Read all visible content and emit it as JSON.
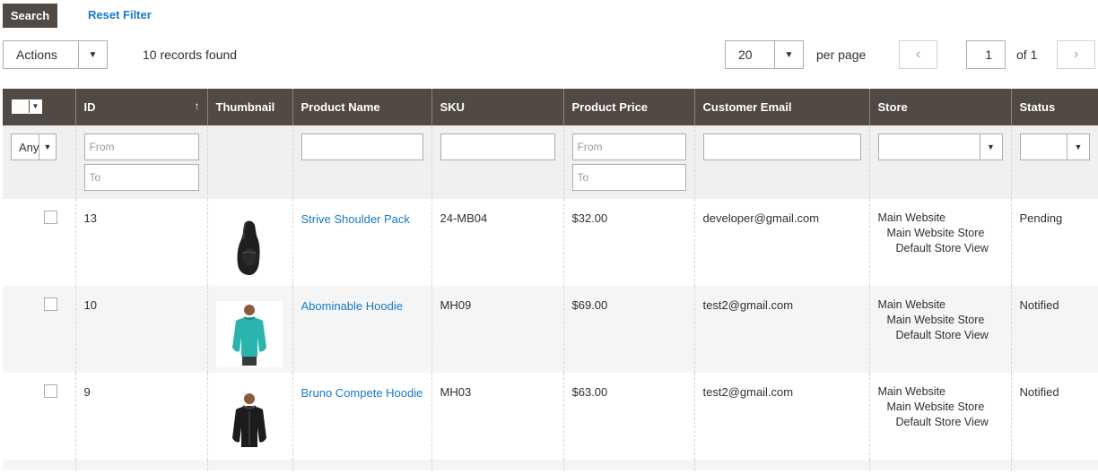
{
  "top": {
    "search_label": "Search",
    "reset_filter_label": "Reset Filter"
  },
  "toolbar": {
    "actions_label": "Actions",
    "records_found": "10 records found",
    "per_page_value": "20",
    "per_page_label": "per page",
    "page_current": "1",
    "page_total": "of 1",
    "prev_icon": "chevron-left-icon",
    "next_icon": "chevron-right-icon"
  },
  "grid": {
    "columns": [
      "ID",
      "Thumbnail",
      "Product Name",
      "SKU",
      "Product Price",
      "Customer Email",
      "Store",
      "Status"
    ],
    "sort_indicator": "↑",
    "filters": {
      "mass_any": "Any",
      "id_from_placeholder": "From",
      "id_to_placeholder": "To",
      "price_from_placeholder": "From",
      "price_to_placeholder": "To"
    },
    "rows": [
      {
        "id": "13",
        "thumbnail": "backpack-thumbnail",
        "product_name": "Strive Shoulder Pack",
        "sku": "24-MB04",
        "price": "$32.00",
        "email": "developer@gmail.com",
        "store": [
          "Main Website",
          "Main Website Store",
          "Default Store View"
        ],
        "status": "Pending"
      },
      {
        "id": "10",
        "thumbnail": "teal-hoodie-thumbnail",
        "product_name": "Abominable Hoodie",
        "sku": "MH09",
        "price": "$69.00",
        "email": "test2@gmail.com",
        "store": [
          "Main Website",
          "Main Website Store",
          "Default Store View"
        ],
        "status": "Notified"
      },
      {
        "id": "9",
        "thumbnail": "black-hoodie-thumbnail",
        "product_name": "Bruno Compete Hoodie",
        "sku": "MH03",
        "price": "$63.00",
        "email": "test2@gmail.com",
        "store": [
          "Main Website",
          "Main Website Store",
          "Default Store View"
        ],
        "status": "Notified"
      }
    ]
  },
  "colors": {
    "header_bg": "#514943",
    "link": "#1979c3",
    "filter_bg": "#f0f0f0",
    "alt_row_bg": "#f5f5f5"
  }
}
